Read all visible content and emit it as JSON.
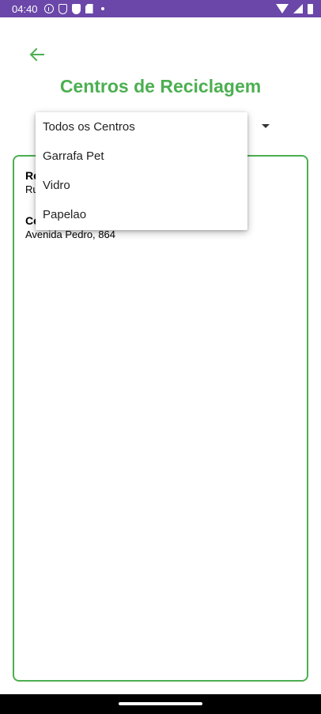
{
  "status_bar": {
    "time": "04:40",
    "icons_left": [
      "info-icon",
      "shield-outline-icon",
      "shield-icon",
      "sd-card-icon",
      "dot-icon"
    ],
    "icons_right": [
      "wifi-icon",
      "signal-icon",
      "battery-icon"
    ]
  },
  "header": {
    "back_icon": "arrow-back-icon",
    "title": "Centros de Reciclagem"
  },
  "filter": {
    "options": [
      "Todos os Centros",
      "Garrafa Pet",
      "Vidro",
      "Papelao"
    ]
  },
  "list": {
    "items": [
      {
        "name": "Re",
        "address": "Ru"
      },
      {
        "name": "Ce",
        "address": "Avenida Pedro, 864"
      }
    ]
  },
  "colors": {
    "accent": "#4caf50",
    "status_bar": "#6a47a8"
  }
}
